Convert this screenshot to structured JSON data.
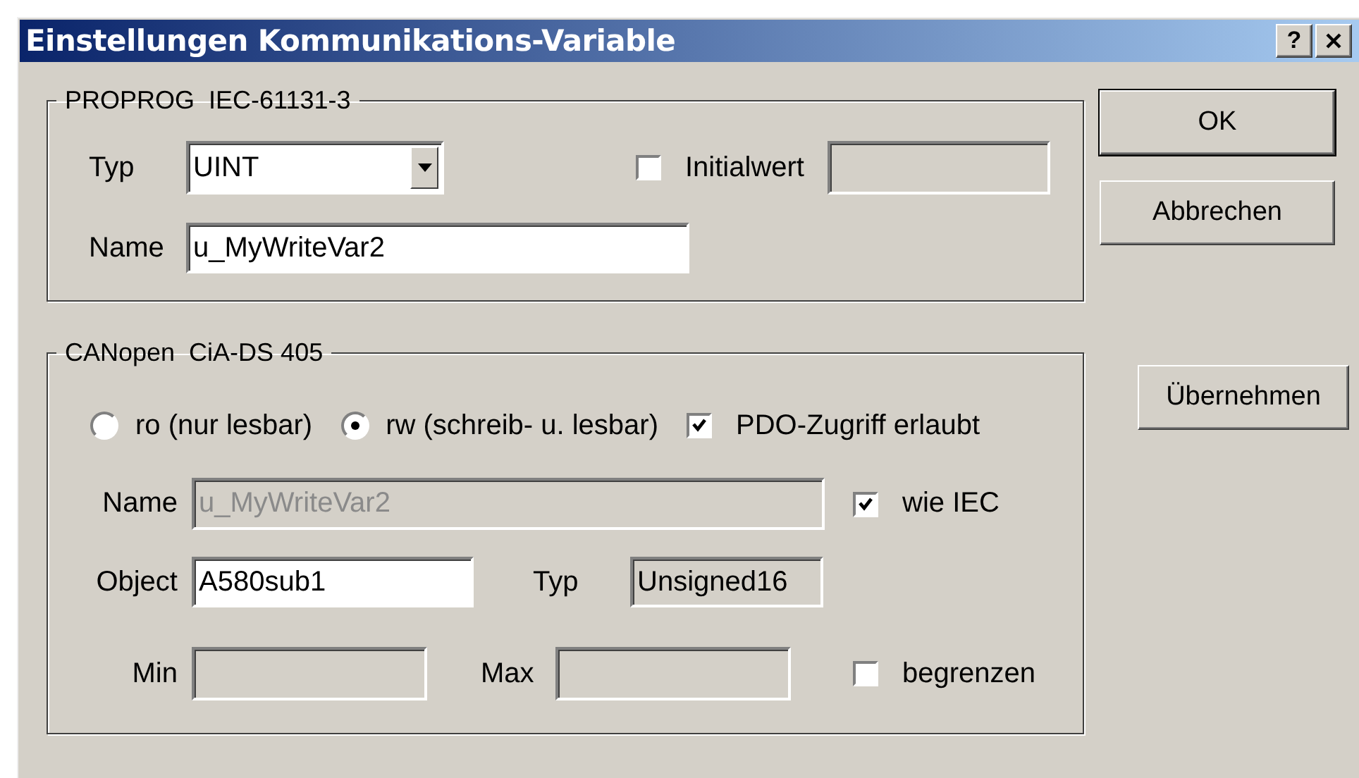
{
  "window": {
    "title": "Einstellungen Kommunikations-Variable",
    "help_button": "?"
  },
  "proprog": {
    "legend": "PROPROG  IEC-61131-3",
    "typ": {
      "label": "Typ",
      "value": "UINT"
    },
    "initialwert": {
      "label": "Initialwert",
      "checked": false
    },
    "name": {
      "label": "Name",
      "value": "u_MyWriteVar2"
    }
  },
  "canopen": {
    "legend": "CANopen  CiA-DS 405",
    "access": [
      {
        "label": "ro (nur lesbar)",
        "selected": false
      },
      {
        "label": "rw (schreib- u. lesbar)",
        "selected": true
      }
    ],
    "pdo": {
      "label": "PDO-Zugriff erlaubt",
      "checked": true
    },
    "name": {
      "label": "Name",
      "value": "u_MyWriteVar2",
      "disabled": true
    },
    "wie_iec": {
      "label": "wie IEC",
      "checked": true
    },
    "object": {
      "label": "Object",
      "value": "A580sub1",
      "disabled": false
    },
    "typ": {
      "label": "Typ",
      "value": "Unsigned16",
      "readonly": true
    },
    "min": {
      "label": "Min",
      "disabled": true
    },
    "max": {
      "label": "Max",
      "disabled": true
    },
    "begrenzen": {
      "label": "begrenzen",
      "checked": false
    }
  },
  "buttons": [
    {
      "label": "OK"
    },
    {
      "label": "Abbrechen"
    },
    {
      "label": "Übernehmen"
    }
  ]
}
